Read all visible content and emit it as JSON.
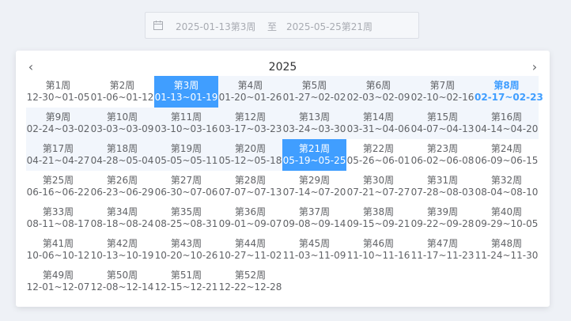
{
  "range_input": {
    "start": "2025-01-13第3周",
    "separator": "至",
    "end": "2025-05-25第21周",
    "icon": "calendar-icon"
  },
  "panel": {
    "year": "2025",
    "prev_icon": "chevron-left-icon",
    "next_icon": "chevron-right-icon",
    "colors": {
      "accent": "#409eff",
      "range_bg": "#f2f6fc",
      "text": "#606266"
    },
    "selected_start_index": 2,
    "selected_end_index": 20,
    "today_index": 7,
    "weeks": [
      {
        "label": "第1周",
        "dates": "12-30~01-05"
      },
      {
        "label": "第2周",
        "dates": "01-06~01-12"
      },
      {
        "label": "第3周",
        "dates": "01-13~01-19"
      },
      {
        "label": "第4周",
        "dates": "01-20~01-26"
      },
      {
        "label": "第5周",
        "dates": "01-27~02-02"
      },
      {
        "label": "第6周",
        "dates": "02-03~02-09"
      },
      {
        "label": "第7周",
        "dates": "02-10~02-16"
      },
      {
        "label": "第8周",
        "dates": "02-17~02-23"
      },
      {
        "label": "第9周",
        "dates": "02-24~03-02"
      },
      {
        "label": "第10周",
        "dates": "03-03~03-09"
      },
      {
        "label": "第11周",
        "dates": "03-10~03-16"
      },
      {
        "label": "第12周",
        "dates": "03-17~03-23"
      },
      {
        "label": "第13周",
        "dates": "03-24~03-30"
      },
      {
        "label": "第14周",
        "dates": "03-31~04-06"
      },
      {
        "label": "第15周",
        "dates": "04-07~04-13"
      },
      {
        "label": "第16周",
        "dates": "04-14~04-20"
      },
      {
        "label": "第17周",
        "dates": "04-21~04-27"
      },
      {
        "label": "第18周",
        "dates": "04-28~05-04"
      },
      {
        "label": "第19周",
        "dates": "05-05~05-11"
      },
      {
        "label": "第20周",
        "dates": "05-12~05-18"
      },
      {
        "label": "第21周",
        "dates": "05-19~05-25"
      },
      {
        "label": "第22周",
        "dates": "05-26~06-01"
      },
      {
        "label": "第23周",
        "dates": "06-02~06-08"
      },
      {
        "label": "第24周",
        "dates": "06-09~06-15"
      },
      {
        "label": "第25周",
        "dates": "06-16~06-22"
      },
      {
        "label": "第26周",
        "dates": "06-23~06-29"
      },
      {
        "label": "第27周",
        "dates": "06-30~07-06"
      },
      {
        "label": "第28周",
        "dates": "07-07~07-13"
      },
      {
        "label": "第29周",
        "dates": "07-14~07-20"
      },
      {
        "label": "第30周",
        "dates": "07-21~07-27"
      },
      {
        "label": "第31周",
        "dates": "07-28~08-03"
      },
      {
        "label": "第32周",
        "dates": "08-04~08-10"
      },
      {
        "label": "第33周",
        "dates": "08-11~08-17"
      },
      {
        "label": "第34周",
        "dates": "08-18~08-24"
      },
      {
        "label": "第35周",
        "dates": "08-25~08-31"
      },
      {
        "label": "第36周",
        "dates": "09-01~09-07"
      },
      {
        "label": "第37周",
        "dates": "09-08~09-14"
      },
      {
        "label": "第38周",
        "dates": "09-15~09-21"
      },
      {
        "label": "第39周",
        "dates": "09-22~09-28"
      },
      {
        "label": "第40周",
        "dates": "09-29~10-05"
      },
      {
        "label": "第41周",
        "dates": "10-06~10-12"
      },
      {
        "label": "第42周",
        "dates": "10-13~10-19"
      },
      {
        "label": "第43周",
        "dates": "10-20~10-26"
      },
      {
        "label": "第44周",
        "dates": "10-27~11-02"
      },
      {
        "label": "第45周",
        "dates": "11-03~11-09"
      },
      {
        "label": "第46周",
        "dates": "11-10~11-16"
      },
      {
        "label": "第47周",
        "dates": "11-17~11-23"
      },
      {
        "label": "第48周",
        "dates": "11-24~11-30"
      },
      {
        "label": "第49周",
        "dates": "12-01~12-07"
      },
      {
        "label": "第50周",
        "dates": "12-08~12-14"
      },
      {
        "label": "第51周",
        "dates": "12-15~12-21"
      },
      {
        "label": "第52周",
        "dates": "12-22~12-28"
      }
    ]
  }
}
